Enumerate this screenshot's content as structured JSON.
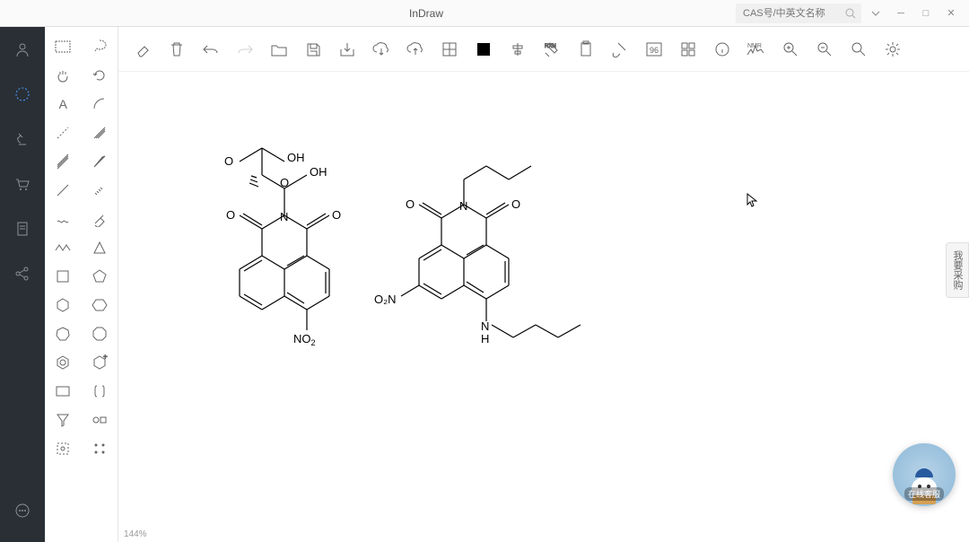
{
  "app": {
    "title": "InDraw"
  },
  "search": {
    "placeholder": "CAS号/中英文名称"
  },
  "status": {
    "zoom": "144%"
  },
  "sidetab": {
    "label": "我要采购"
  },
  "assistant": {
    "label": "在线客服"
  },
  "toolbar": {
    "items": [
      "eraser",
      "trash",
      "undo",
      "redo",
      "open",
      "save",
      "export",
      "cloud-down",
      "cloud-up",
      "grid",
      "color",
      "align",
      "clean",
      "paste",
      "clip",
      "number",
      "grid2",
      "info",
      "nmr",
      "zoom-fit",
      "zoom-out",
      "zoom-in",
      "settings"
    ]
  },
  "tools": {
    "rows": [
      [
        "marquee",
        "lasso"
      ],
      [
        "hand",
        "rotate"
      ],
      [
        "text",
        "arc"
      ],
      [
        "bond-dash",
        "bond-double"
      ],
      [
        "bond-wedge",
        "bond-bold"
      ],
      [
        "bond-single",
        "bond-hash"
      ],
      [
        "bond-wavy",
        "eraser2"
      ],
      [
        "chain",
        "triangle"
      ],
      [
        "square",
        "pentagon"
      ],
      [
        "hexagon",
        "hexagon2"
      ],
      [
        "cycloheptane",
        "cyclooctane"
      ],
      [
        "benzene",
        "charged-ring"
      ],
      [
        "rect",
        "bracket"
      ],
      [
        "funnel",
        "template"
      ],
      [
        "group",
        "dots"
      ]
    ]
  },
  "rail": {
    "items": [
      "user",
      "selection",
      "microscope",
      "cart",
      "document",
      "share",
      "chat"
    ]
  },
  "molecules": {
    "mol1": {
      "labels": {
        "oh1": "OH",
        "oh2": "OH",
        "o1": "O",
        "o2": "O",
        "o3": "O",
        "o4": "O",
        "n": "N",
        "no2": "NO"
      }
    },
    "mol2": {
      "labels": {
        "o1": "O",
        "o2": "O",
        "n1": "N",
        "o2n": "O₂N",
        "nh": "N",
        "h": "H"
      }
    }
  }
}
